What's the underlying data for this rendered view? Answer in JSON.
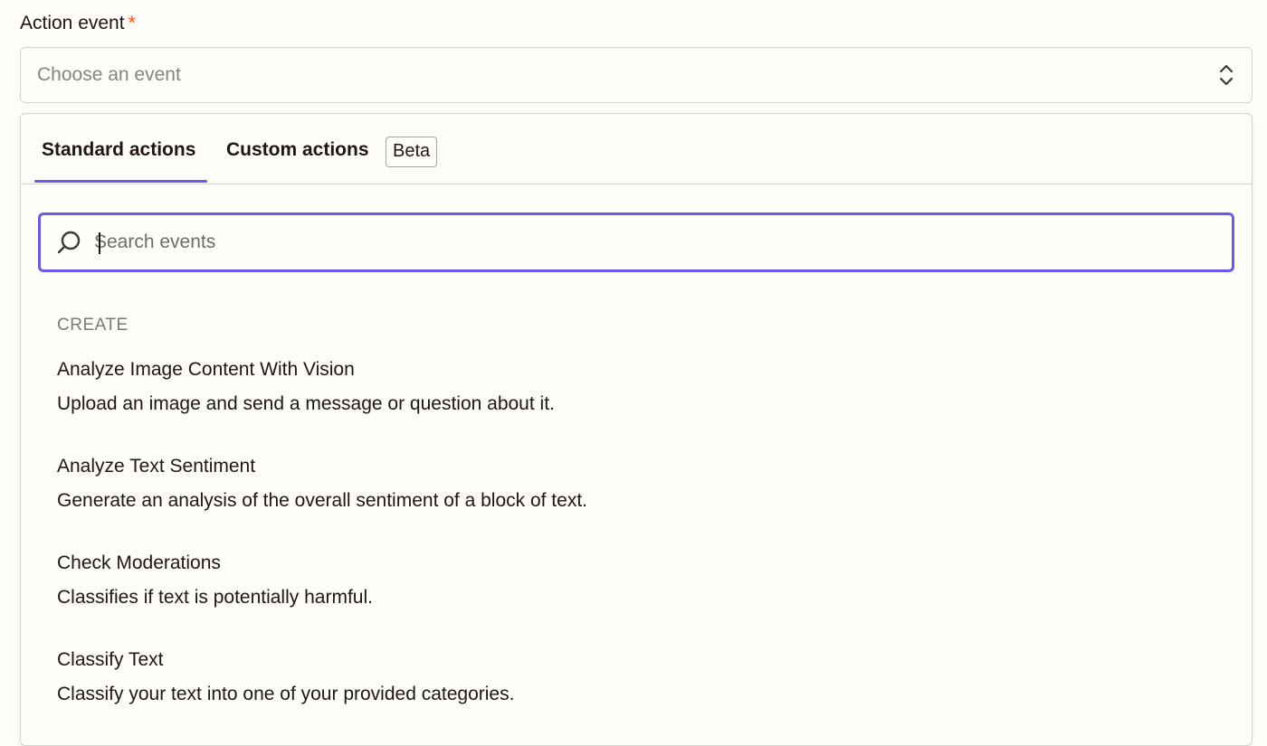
{
  "field": {
    "label": "Action event",
    "required_mark": "*",
    "select_placeholder": "Choose an event"
  },
  "tabs": {
    "standard": "Standard actions",
    "custom": "Custom actions",
    "beta_badge": "Beta",
    "active": "standard"
  },
  "search": {
    "placeholder": "Search events",
    "value": ""
  },
  "section": {
    "header": "CREATE"
  },
  "events": [
    {
      "title": "Analyze Image Content With Vision",
      "description": "Upload an image and send a message or question about it."
    },
    {
      "title": "Analyze Text Sentiment",
      "description": "Generate an analysis of the overall sentiment of a block of text."
    },
    {
      "title": "Check Moderations",
      "description": "Classifies if text is potentially harmful."
    },
    {
      "title": "Classify Text",
      "description": "Classify your text into one of your provided categories."
    }
  ],
  "icons": {
    "select": "chevron-up-down-icon",
    "search": "search-icon"
  },
  "colors": {
    "accent": "#695be8",
    "required": "#ff4f00",
    "background": "#fffdf9",
    "border": "#d6d3cf"
  }
}
